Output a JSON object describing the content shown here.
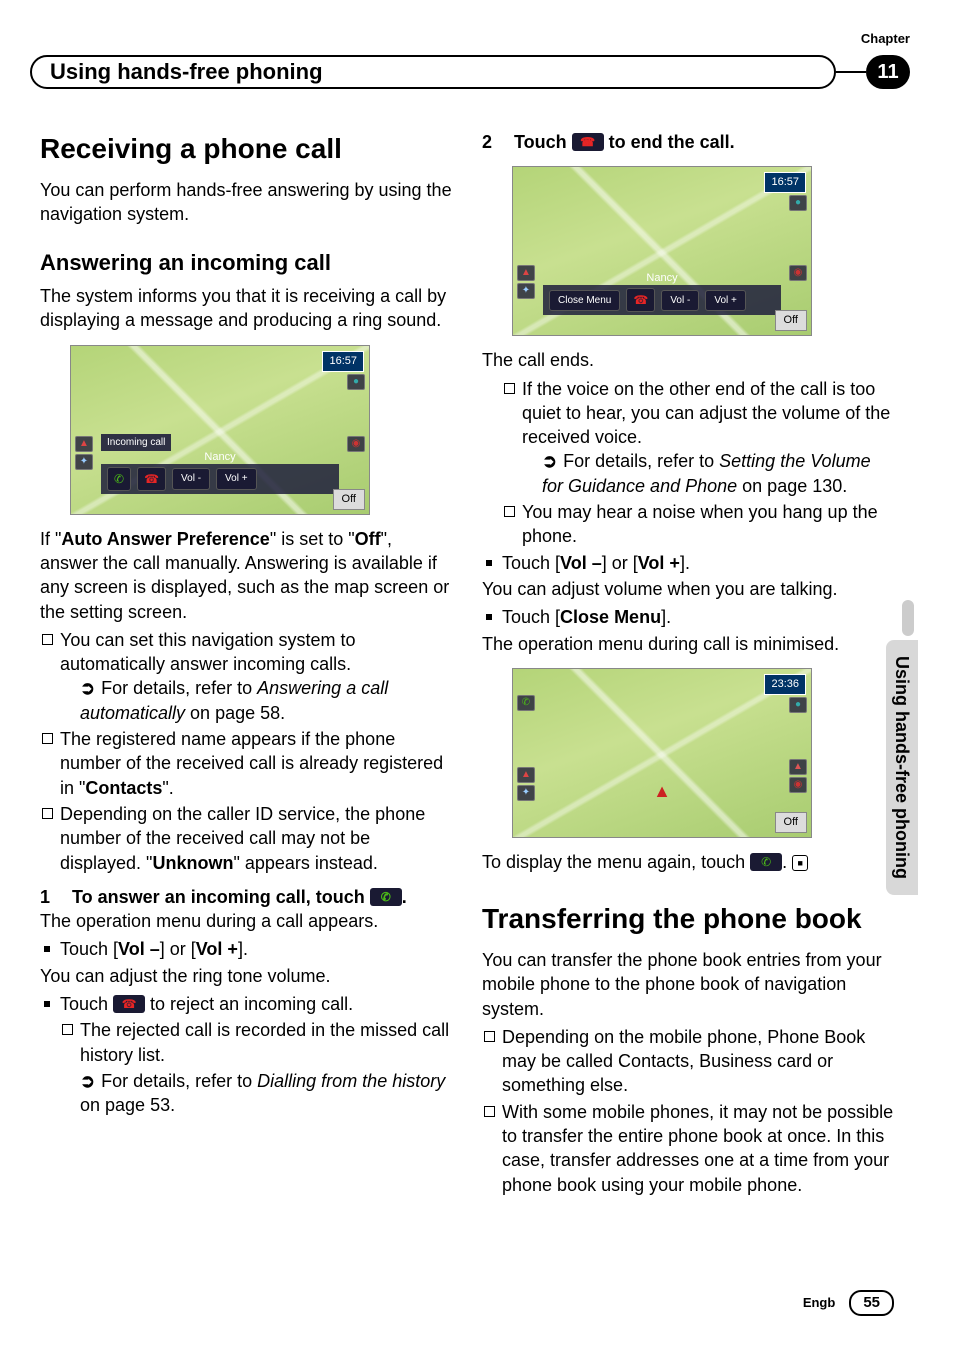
{
  "chapter": {
    "label": "Chapter",
    "number": "11",
    "title": "Using hands-free phoning"
  },
  "side_tab": "Using hands-free phoning",
  "footer": {
    "lang": "Engb",
    "page": "55"
  },
  "left": {
    "h1": "Receiving a phone call",
    "intro": "You can perform hands-free answering by using the navigation system.",
    "h2": "Answering an incoming call",
    "sub_intro": "The system informs you that it is receiving a call by displaying a message and producing a ring sound.",
    "ss1": {
      "time": "16:57",
      "incoming_label": "Incoming call",
      "caller": "Nancy",
      "vol_minus": "Vol -",
      "vol_plus": "Vol +",
      "off": "Off"
    },
    "para_auto_1": "If \"",
    "para_auto_bold1": "Auto Answer Preference",
    "para_auto_2": "\" is set to \"",
    "para_auto_bold2": "Off",
    "para_auto_3": "\", answer the call manually. Answering is available if any screen is displayed, such as the map screen or the setting screen.",
    "li1": "You can set this navigation system to automatically answer incoming calls.",
    "li1_ref_pre": "For details, refer to ",
    "li1_ref_em": "Answering a call automatically",
    "li1_ref_post": " on page 58.",
    "li2_a": "The registered name appears if the phone number of the received call is already registered in \"",
    "li2_b": "Contacts",
    "li2_c": "\".",
    "li3_a": "Depending on the caller ID service, the phone number of the received call may not be displayed. \"",
    "li3_b": "Unknown",
    "li3_c": "\" appears instead.",
    "step1_num": "1",
    "step1_a": "To answer an incoming call, touch ",
    "step1_b": ".",
    "step1_after": "The operation menu during a call appears.",
    "vol_line_a": "Touch [",
    "vol_line_b": "Vol –",
    "vol_line_c": "] or [",
    "vol_line_d": "Vol +",
    "vol_line_e": "].",
    "vol_after": "You can adjust the ring tone volume.",
    "reject_a": "Touch ",
    "reject_b": " to reject an incoming call.",
    "reject_sub": "The rejected call is recorded in the missed call history list.",
    "reject_ref_pre": "For details, refer to ",
    "reject_ref_em": "Dialling from the history",
    "reject_ref_post": " on page 53."
  },
  "right": {
    "step2_num": "2",
    "step2_a": "Touch ",
    "step2_b": " to end the call.",
    "ss2": {
      "time": "16:57",
      "caller": "Nancy",
      "close_menu": "Close Menu",
      "vol_minus": "Vol -",
      "vol_plus": "Vol +",
      "off": "Off"
    },
    "call_ends": "The call ends.",
    "li1": "If the voice on the other end of the call is too quiet to hear, you can adjust the volume of the received voice.",
    "li1_ref_pre": "For details, refer to ",
    "li1_ref_em": "Setting the Volume for Guidance and Phone",
    "li1_ref_post": " on page 130.",
    "li2": "You may hear a noise when you hang up the phone.",
    "vol_line_a": "Touch [",
    "vol_line_b": "Vol –",
    "vol_line_c": "] or [",
    "vol_line_d": "Vol +",
    "vol_line_e": "].",
    "vol_after": "You can adjust volume when you are talking.",
    "close_a": "Touch [",
    "close_b": "Close Menu",
    "close_c": "].",
    "close_after": "The operation menu during call is minimised.",
    "ss3": {
      "time": "23:36",
      "off": "Off"
    },
    "redisplay_a": "To display the menu again, touch ",
    "redisplay_b": ".",
    "h1_transfer": "Transferring the phone book",
    "transfer_intro": "You can transfer the phone book entries from your mobile phone to the phone book of navigation system.",
    "t_li1": "Depending on the mobile phone, Phone Book may be called Contacts, Business card or something else.",
    "t_li2": "With some mobile phones, it may not be possible to transfer the entire phone book at once. In this case, transfer addresses one at a time from your phone book using your mobile phone."
  }
}
